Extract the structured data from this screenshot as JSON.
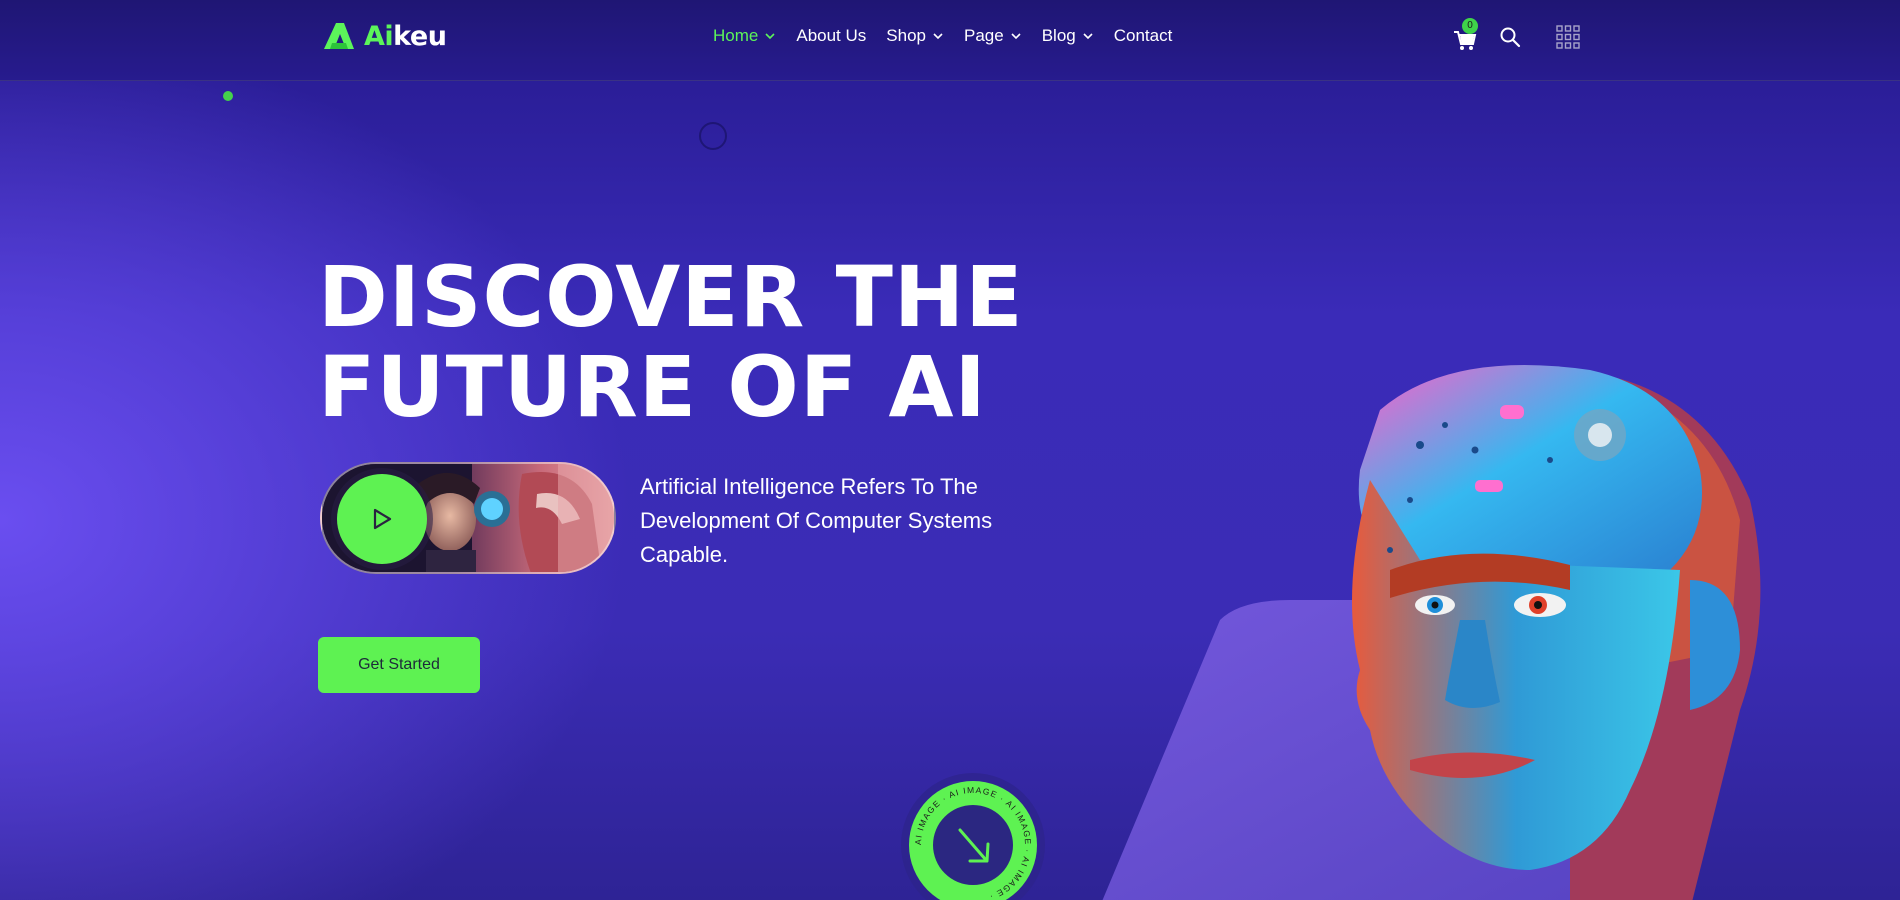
{
  "brand": {
    "logo_ai": "Ai",
    "logo_rest": "keu"
  },
  "nav": {
    "items": [
      {
        "label": "Home",
        "active": true,
        "has_dropdown": true
      },
      {
        "label": "About Us",
        "active": false,
        "has_dropdown": false
      },
      {
        "label": "Shop",
        "active": false,
        "has_dropdown": true
      },
      {
        "label": "Page",
        "active": false,
        "has_dropdown": true
      },
      {
        "label": "Blog",
        "active": false,
        "has_dropdown": true
      },
      {
        "label": "Contact",
        "active": false,
        "has_dropdown": false
      }
    ],
    "cart_count": "0",
    "icons": [
      "cart-icon",
      "search-icon",
      "grid-menu-icon"
    ]
  },
  "hero": {
    "headline_line1": "DISCOVER THE",
    "headline_line2": "FUTURE OF AI",
    "description": "Artificial Intelligence Refers To The Development Of Computer Systems Capable.",
    "cta_label": "Get Started",
    "badge_text": "AI IMAGE · AI IMAGE · AI IMAGE · AI IMAGE ·"
  },
  "colors": {
    "accent": "#5ef252",
    "background": "#3a2bb8",
    "header": "#221781"
  }
}
